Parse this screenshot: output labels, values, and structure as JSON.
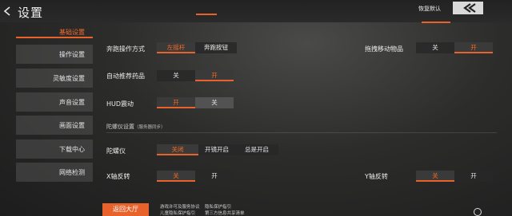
{
  "header": {
    "title": "设置",
    "restore_default_label": "恢复默认"
  },
  "colors": {
    "accent": "#e8622c",
    "active_text": "#ff6a1e"
  },
  "sidebar": {
    "items": [
      {
        "label": "基础设置",
        "active": true
      },
      {
        "label": "操作设置"
      },
      {
        "label": "灵敏度设置"
      },
      {
        "label": "声音设置"
      },
      {
        "label": "画面设置"
      },
      {
        "label": "下载中心"
      },
      {
        "label": "网络检测"
      }
    ]
  },
  "settings": {
    "sprint_mode": {
      "label": "奔跑操作方式",
      "options": [
        "左摇杆",
        "奔跑按钮"
      ],
      "selected": 0
    },
    "drag_move_items": {
      "label": "拖拽移动物品",
      "options": [
        "关",
        "开"
      ],
      "selected": 1
    },
    "auto_recommend_meds": {
      "label": "自动推荐药品",
      "options": [
        "关",
        "开"
      ],
      "selected": 1
    },
    "hud_shake": {
      "label": "HUD震动",
      "options": [
        "开",
        "关"
      ],
      "selected": 0
    },
    "gyro_section": {
      "label": "陀螺仪设置",
      "note": "（服务器同步）"
    },
    "gyroscope": {
      "label": "陀螺仪",
      "options": [
        "关闭",
        "开镜开启",
        "总是开启"
      ],
      "selected": 0
    },
    "x_invert": {
      "label": "X轴反转",
      "options": [
        "关",
        "开"
      ],
      "selected": 0
    },
    "y_invert": {
      "label": "Y轴反转",
      "options": [
        "关",
        "开"
      ],
      "selected": 0
    }
  },
  "footer": {
    "lobby_button": "返回大厅",
    "links": [
      "游戏许可及服务协议",
      "隐私保护指引",
      "儿童隐私保护指引",
      "第三方信息共享清单"
    ]
  }
}
